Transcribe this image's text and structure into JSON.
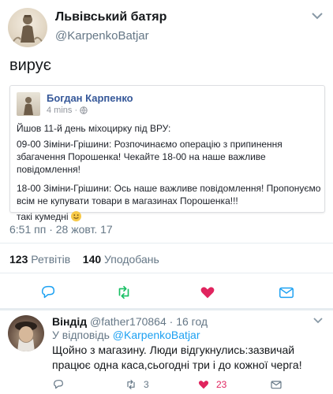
{
  "tweet": {
    "author_name": "Львівський батяр",
    "author_handle": "@KarpenkoBatjar",
    "text": "вирує",
    "timestamp": "6:51 пп · 28 жовт. 17",
    "retweets_count": "123",
    "retweets_label": "Ретвітів",
    "likes_count": "140",
    "likes_label": "Уподобань"
  },
  "embed": {
    "author": "Богдан Карпенко",
    "time": "4 mins ·",
    "line1": "Йшов 11-й день міхоцирку під ВРУ:",
    "para1": "09-00 Зіміни-Грішини: Розпочинаємо операцію з припинення збагачення Порошенка! Чекайте 18-00 на наше важливе повідомлення!",
    "para2": "18-00 Зіміни-Грішини: Ось наше важливе повідомлення! Пропонуємо всім не купувати товари в магазинах Порошенка!!!",
    "para3": "такі кумедні"
  },
  "reply": {
    "name": "Віндід",
    "handle": "@father170864",
    "time": "· 16 год",
    "in_reply_prefix": "У відповідь",
    "in_reply_handle": "@KarpenkoBatjar",
    "text": "Щойно з магазину. Люди відгукнулись:зазвичай працює одна каса,сьогодні три і до кожної черга!",
    "retweets": "3",
    "likes": "23"
  },
  "colors": {
    "accent": "#1da1f2",
    "retweet": "#17bf63",
    "like": "#e0245e",
    "fb_link": "#365899",
    "muted": "#657786"
  },
  "icons": [
    "chevron-down-icon",
    "globe-icon",
    "smiley-icon",
    "reply-icon",
    "retweet-icon",
    "heart-icon",
    "mail-icon"
  ]
}
